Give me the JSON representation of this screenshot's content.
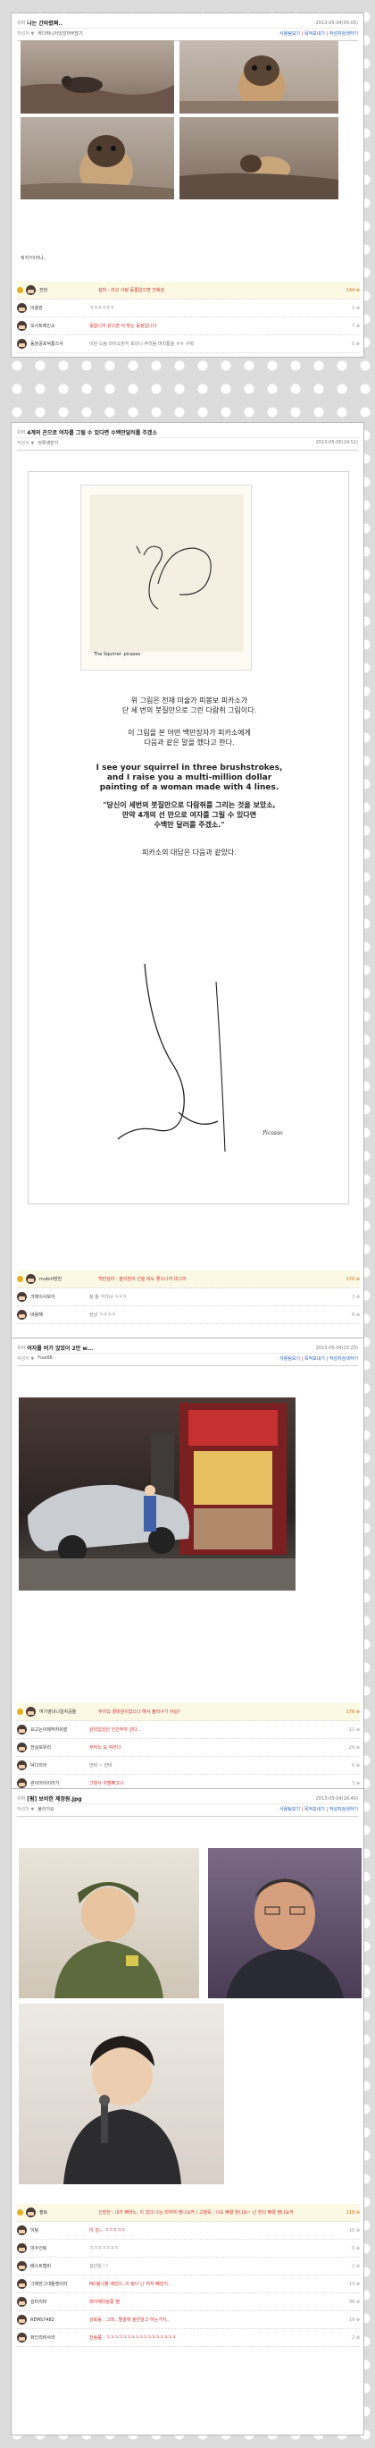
{
  "posts": [
    {
      "category": "유머",
      "title": "나는 간바렸쪄..",
      "date": "2013-05-04(05:05)",
      "author_prefix": "작성자 ▼",
      "author": "하다하니아잉앙까무많기",
      "links": [
        "사용팀보기",
        "목적보내기",
        "작성자검색하기"
      ],
      "body_text": "뭐지?이러냐..",
      "comments": [
        {
          "name": "전당",
          "text": "설마 : 라고 사랑 동롱없으면 간베검",
          "score": "144 ⊕",
          "best": true
        },
        {
          "name": "이용만",
          "text": "ㅋㅋㅋㅋㅋㅋ",
          "score": "1 ⊕",
          "best": false
        },
        {
          "name": "보샤트케인소",
          "text": "몽합니까 같으면 이 맞는 동정입니다",
          "score": "7 ⊕",
          "best": false
        },
        {
          "name": "동양공포덕롱스샤",
          "text": "이런 드림 라이오한지 토마니 부러움 머리통을 ㅎㅎ 구력",
          "score": "0 ⊕",
          "best": false
        }
      ]
    },
    {
      "category": "유머",
      "title": "4계의 끈으로 여자를 그릴 수 있다면 수백만달러를 주겠소",
      "date": "2013-05-05(19:51)",
      "author_prefix": "작성자 ▼",
      "author": "의류생한가",
      "drawing_caption": "The Squirrel- picasso",
      "korean_block1": [
        "위 그림은 천재 미술가 피봉보 피카소가",
        "단 세 번의 붓질만으로 그린 다람쥐 그림이다."
      ],
      "korean_block2": [
        "이 그림을 본 어떤 백만장자가 피카소에게",
        "다음과 같은 말을 했다고 한다."
      ],
      "english_block": [
        "I see your squirrel in three brushstrokes,",
        "and I raise you a multi-million dollar",
        "painting of a woman made with 4 lines."
      ],
      "korean_block3": [
        "\"당신이 세번의 붓질만으로 다람쥐를 그리는 것을 보았소,",
        "만약 4개의 선 만으로 여자를 그릴 수 있다면",
        "수백만 달러를 주겠소.\""
      ],
      "korean_block4": [
        "피카소의 대답은 다음과 같았다."
      ],
      "signature": "Picasso",
      "comments": [
        {
          "name": "mubirl망한",
          "text": "백만달러 : 솔리빙의 선을 씌도 좋으니까 미그라",
          "score": "170 ⊕",
          "best": true
        },
        {
          "name": "크레이사보아",
          "text": "참 돌 거기냐 ㅋㅋㅋ",
          "score": "3 ⊕",
          "best": false
        },
        {
          "name": "바람해",
          "text": "완낭 ㅋㅋㅋㅋ",
          "score": "8 ⊕",
          "best": false
        }
      ]
    },
    {
      "category": "유머",
      "title": "여자를 버거 앉았어 2만 w...",
      "date": "2013-05-04(15:23)",
      "author_prefix": "작성자 ▼",
      "author": "Foal88",
      "links": [
        "사용팀보기",
        "목적보내기",
        "작성자검색하기"
      ],
      "comments": [
        {
          "name": "여기영녀니일자공들",
          "text": "무치있 경비원이었으나 해서 불러구가 아닐?",
          "score": "176 ⊕",
          "best": true
        },
        {
          "name": "요고는이제작자유발",
          "text": "원리입있던 인간주자 감다..",
          "score": "11 ⊕",
          "best": false
        },
        {
          "name": "전실모위리",
          "text": "무하노 모 여러다",
          "score": "29 ⊕",
          "best": false
        },
        {
          "name": "덕다의어",
          "text": "반비 ~ 반비",
          "score": "0 ⊕",
          "best": false
        },
        {
          "name": "관이어이이어가",
          "text": "그렇사 위했빠고나",
          "score": "3 ⊕",
          "best": false
        }
      ]
    },
    {
      "category": "유머",
      "title": "[펌] 보비한 제정원.Jpg",
      "date": "2013-05-04(16:40)",
      "author_prefix": "작성자 ▼",
      "author": "불라가요",
      "links": [
        "사용팀보기",
        "목적보내기",
        "작성자검색하기"
      ],
      "comments": [
        {
          "name": "필토",
          "text": "신장헌 : 내가 빠하노, 이 있다 나는 미하여 탠나요카 / 고창욱 : 나도 빠렸 탠나요~ 난 한다 빠렸 탠나요카",
          "score": "118 ⊕",
          "best": true
        },
        {
          "name": "이팅",
          "text": "이 김ㄴ ㅋㅋㅋㅋㅋ",
          "score": "10 ⊕",
          "best": false
        },
        {
          "name": "미수인팅",
          "text": "ㅋㅋㅋㅋㅋㅋㅋ",
          "score": "0 ⊕",
          "best": false
        },
        {
          "name": "베스트랩비",
          "text": "김단임 ! !",
          "score": "2 ⊕",
          "best": false
        },
        {
          "name": "그래한그대들쟁이라",
          "text": "MC봉나몰 배었다..이 탐다 난 여자 빼었지..",
          "score": "13 ⊕",
          "best": false
        },
        {
          "name": "김타리바",
          "text": "파이해리링롱 쨈",
          "score": "38 ⊕",
          "best": false
        },
        {
          "name": "REMS7482",
          "text": "강호동 : 그래.. 별꼴에 울한알고 하는거지..",
          "score": "19 ⊕",
          "best": false
        },
        {
          "name": "화인리비사라",
          "text": "천송쯤 : ㅋㅋㅋㅋㅋㅋㅋㅋㅋㅋㅋㅋㅋㅋㅋㅋㅋ",
          "score": "2 ⊕",
          "best": false
        }
      ]
    }
  ],
  "colors": {
    "page_bg": "#dcdcdc",
    "link_blue": "#2a60b8",
    "red": "#d03030",
    "best_bg": "#fbf8e4"
  }
}
